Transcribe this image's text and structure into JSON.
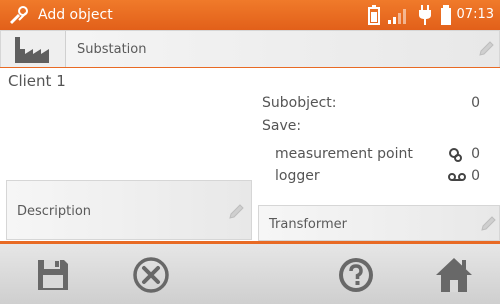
{
  "header": {
    "title": "Add object",
    "time": "07:13"
  },
  "object_field": {
    "value": "Substation"
  },
  "client_name": "Client 1",
  "info": {
    "subobject_label": "Subobject:",
    "subobject_value": "0",
    "save_label": "Save:",
    "measurement_point_label": "measurement point",
    "measurement_point_value": "0",
    "logger_label": "logger",
    "logger_value": "0"
  },
  "description_field": {
    "placeholder": "Description"
  },
  "transformer_field": {
    "placeholder": "Transformer"
  },
  "colors": {
    "accent": "#e86a24",
    "bar_bg": "#d9d9d9",
    "icon": "#6a6a6a"
  },
  "icons": [
    "tools-icon",
    "battery-icon",
    "signal-icon",
    "plug-icon",
    "battery-level-icon",
    "factory-icon",
    "pencil-icon",
    "save-icon",
    "close-icon",
    "help-icon",
    "home-icon",
    "measurement-point-icon",
    "logger-icon"
  ]
}
